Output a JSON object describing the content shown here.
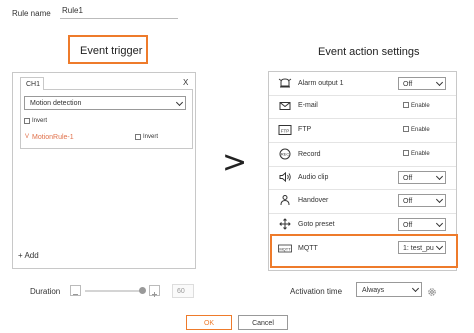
{
  "rule_name": {
    "label": "Rule name",
    "value": "Rule1"
  },
  "event_trigger": {
    "heading": "Event trigger",
    "tab_label": "CH1",
    "close_label": "X",
    "trigger_type": "Motion detection",
    "invert_label": "Invert",
    "motion_rule_label": "MotionRule-1",
    "motion_rule_invert_label": "Invert",
    "add_label": "+ Add"
  },
  "arrow": ">",
  "event_action": {
    "heading": "Event action settings",
    "rows": [
      {
        "icon": "alarm-output-icon",
        "label": "Alarm output 1",
        "control": "select",
        "value": "Off"
      },
      {
        "icon": "email-icon",
        "label": "E-mail",
        "control": "checkbox",
        "value": "Enable"
      },
      {
        "icon": "ftp-icon",
        "label": "FTP",
        "control": "checkbox",
        "value": "Enable"
      },
      {
        "icon": "record-icon",
        "label": "Record",
        "control": "checkbox",
        "value": "Enable"
      },
      {
        "icon": "audio-clip-icon",
        "label": "Audio clip",
        "control": "select",
        "value": "Off"
      },
      {
        "icon": "handover-icon",
        "label": "Handover",
        "control": "select",
        "value": "Off"
      },
      {
        "icon": "goto-preset-icon",
        "label": "Goto preset",
        "control": "select",
        "value": "Off"
      },
      {
        "icon": "mqtt-icon",
        "label": "MQTT",
        "control": "select",
        "value": "1: test_pu"
      }
    ]
  },
  "duration": {
    "label": "Duration",
    "value": "60"
  },
  "activation": {
    "label": "Activation time",
    "value": "Always"
  },
  "buttons": {
    "ok": "OK",
    "cancel": "Cancel"
  },
  "colors": {
    "accent": "#ee7b2b",
    "rule_text": "#e0704a"
  }
}
